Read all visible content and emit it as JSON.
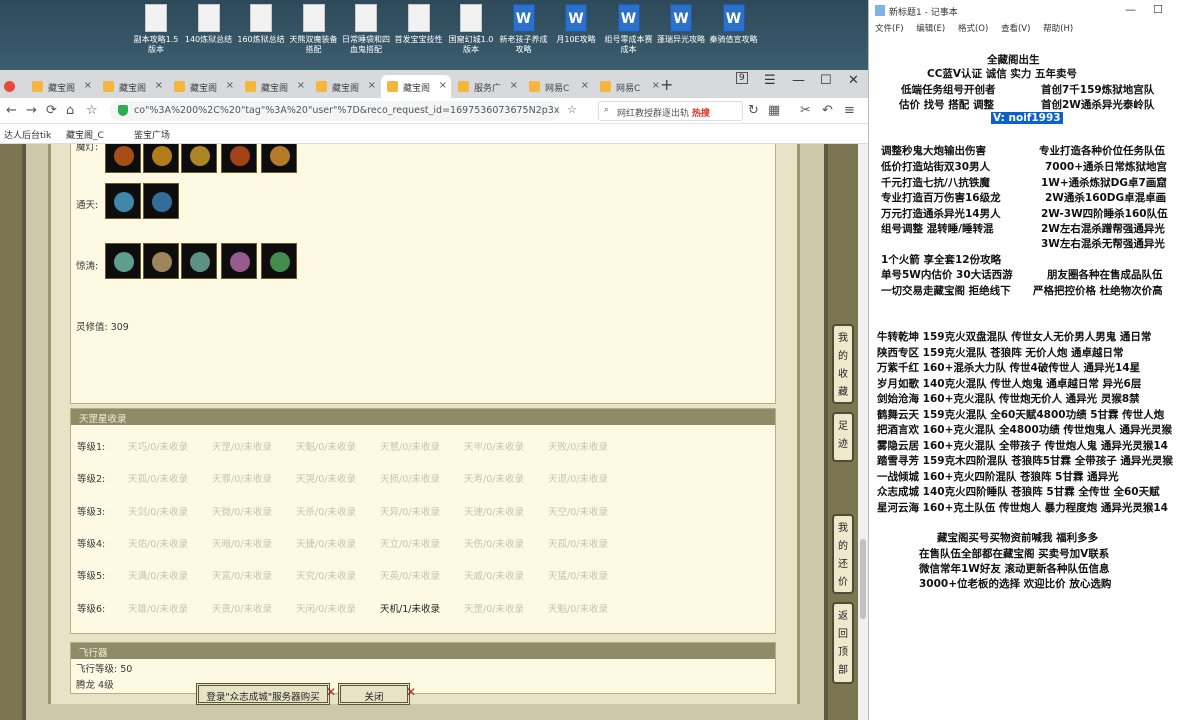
{
  "desktop": {
    "icons": [
      {
        "label": "副本攻略1.5版本",
        "type": "doc"
      },
      {
        "label": "140炼狱总结",
        "type": "doc"
      },
      {
        "label": "160炼狱总结",
        "type": "doc"
      },
      {
        "label": "天熊双魔装备搭配",
        "type": "doc"
      },
      {
        "label": "日常睡袋和四血鬼搭配",
        "type": "doc"
      },
      {
        "label": "首发宝宝技性",
        "type": "doc"
      },
      {
        "label": "国窟幻城1.0版本",
        "type": "doc"
      },
      {
        "label": "新老孩子养成攻略",
        "type": "word"
      },
      {
        "label": "月10E攻略",
        "type": "word"
      },
      {
        "label": "组号零成本赛成本",
        "type": "word"
      },
      {
        "label": "蓬瑞异光攻略",
        "type": "word"
      },
      {
        "label": "秦骑值宣攻略",
        "type": "word"
      }
    ]
  },
  "browser": {
    "tabs": [
      {
        "label": "藏宝阁",
        "active": false
      },
      {
        "label": "藏宝阁",
        "active": false
      },
      {
        "label": "藏宝阁",
        "active": false
      },
      {
        "label": "藏宝阁",
        "active": false
      },
      {
        "label": "藏宝阁",
        "active": false
      },
      {
        "label": "藏宝阁",
        "active": true
      },
      {
        "label": "服务广",
        "active": false
      },
      {
        "label": "网易C",
        "active": false
      },
      {
        "label": "网易C",
        "active": false
      }
    ],
    "tab_count_badge": "9",
    "url": "co\"%3A%200%2C%20\"tag\"%3A%20\"user\"%7D&reco_request_id=1697536073675N2p3x",
    "search_placeholder": "网红教授群逐出轨",
    "search_hot": "热搜",
    "bookmarks": [
      "达人后台tik",
      "藏宝阁_C",
      "鉴宝广场"
    ]
  },
  "page": {
    "top_section": {
      "row1_label": "魔灯:",
      "row2_label": "通天:",
      "row3_label": "惊涛:",
      "lingxiu_label": "灵修值: 309",
      "row1_items": [
        "item-a",
        "item-b",
        "item-c",
        "item-d",
        "item-e"
      ],
      "row2_items": [
        "item-f",
        "item-g"
      ],
      "row3_items": [
        "item-h",
        "item-i",
        "item-j",
        "item-k",
        "item-l"
      ]
    },
    "tiangang": {
      "title": "天罡星收录",
      "levels": [
        {
          "label": "等级1:",
          "cells": [
            "天巧/0/未收录",
            "天罡/0/未收录",
            "天魁/0/未收录",
            "天慧/0/未收录",
            "天牢/0/未收录",
            "天败/0/未收录"
          ]
        },
        {
          "label": "等级2:",
          "cells": [
            "天孤/0/未收录",
            "天罪/0/未收录",
            "天哭/0/未收录",
            "天损/0/未收录",
            "天寿/0/未收录",
            "天退/0/未收录"
          ]
        },
        {
          "label": "等级3:",
          "cells": [
            "天剑/0/未收录",
            "天微/0/未收录",
            "天杀/0/未收录",
            "天异/0/未收录",
            "天速/0/未收录",
            "天空/0/未收录"
          ]
        },
        {
          "label": "等级4:",
          "cells": [
            "天佑/0/未收录",
            "天暗/0/未收录",
            "天捷/0/未收录",
            "天立/0/未收录",
            "天伤/0/未收录",
            "天孤/0/未收录"
          ]
        },
        {
          "label": "等级5:",
          "cells": [
            "天满/0/未收录",
            "天富/0/未收录",
            "天究/0/未收录",
            "天英/0/未收录",
            "天威/0/未收录",
            "天猛/0/未收录"
          ]
        },
        {
          "label": "等级6:",
          "cells": [
            "天雄/0/未收录",
            "天贵/0/未收录",
            "天闲/0/未收录",
            "天机/1/未收录",
            "天罡/0/未收录",
            "天魁/0/未收录"
          ]
        }
      ]
    },
    "aircraft": {
      "title": "飞行器",
      "level": "飞行等级: 50",
      "dragon": "腾龙   4级"
    },
    "buttons": {
      "login": "登录\"众志成城\"服务器购买",
      "close": "关闭"
    },
    "side_tabs": [
      "我的收藏",
      "足迹",
      "我的还价",
      "返回顶部"
    ]
  },
  "notepad": {
    "title": "新标题1 - 记事本",
    "menu": [
      "文件(F)",
      "编辑(E)",
      "格式(O)",
      "查看(V)",
      "帮助(H)"
    ],
    "lines": [
      "全藏阁出生",
      "CC蓝V认证 诚信  实力  五年卖号",
      "低端任务组号开创者",
      "首创7千159炼狱地宫队",
      "估价 找号 搭配 调整",
      "首创2W通杀异光泰岭队",
      "V: noif1993",
      "调整秒鬼大炮输出伤害",
      "专业打造各种价位任务队伍",
      "低价打造站街双30男人",
      "7000+通杀日常炼狱地宫",
      "千元打造七抗/八抗铁魔",
      "1W+通杀炼狱DG卓7画窟",
      "专业打造百万伤害16级龙",
      "2W通杀160DG卓混卓画",
      "万元打造通杀异光14男人",
      "2W-3W四阶睡杀160队伍",
      "组号调整 混转睡/睡转混",
      "2W左右混杀蹭帮强通异光",
      "3W左右混杀无帮强通异光",
      "1个火箭 享全套12份攻略",
      "单号5W内估价 30大话西游",
      "朋友圈各种在售成品队伍",
      "一切交易走藏宝阁 拒绝线下",
      "严格把控价格 杜绝物次价高",
      "牛转乾坤 159克火双盘混队 传世女人无价男人男鬼 通日常",
      "陕西专区 159克火混队 苍狼阵 无价人炮 通卓越日常",
      "万紫千红 160+混杀大力队 传世4破传世人 通异光14星",
      "岁月如歌 140克火混队 传世人炮鬼 通卓越日常 异光6层",
      "剑始沧海 160+克火混队 传世炮无价人 通异光 灵猴8禁",
      "鹤舞云天 159克火混队 全60天赋4800功绩 5甘霖 传世人炮",
      "把酒言欢 160+克火混队 全4800功绩 传世炮鬼人 通异光灵猴",
      "雾隐云居 160+克火混队 全带孩子 传世炮人鬼 通异光灵猴14",
      "踏雪寻芳 159克木四阶混队 苍狼阵5甘霖 全带孩子 通异光灵猴",
      "一战倾城 160+克火四阶混队 苍狼阵 5甘霖 通异光",
      "众志成城 140克火四阶睡队 苍狼阵 5甘霖 全传世 全60天赋",
      "星河云海 160+克土队伍 传世炮人 暴力程度炮 通异光灵猴14",
      "藏宝阁买号买物资前喊我 福利多多",
      "在售队伍全部都在藏宝阁 买卖号加V联系",
      "微信常年1W好友 滚动更新各种队伍信息",
      "3000+位老板的选择 欢迎比价 放心选购"
    ]
  },
  "colors": {
    "panel_bg": "#fdf9e2",
    "panel_head": "#8f8a68",
    "frame": "#7b7552",
    "selection": "#0a62c9"
  }
}
